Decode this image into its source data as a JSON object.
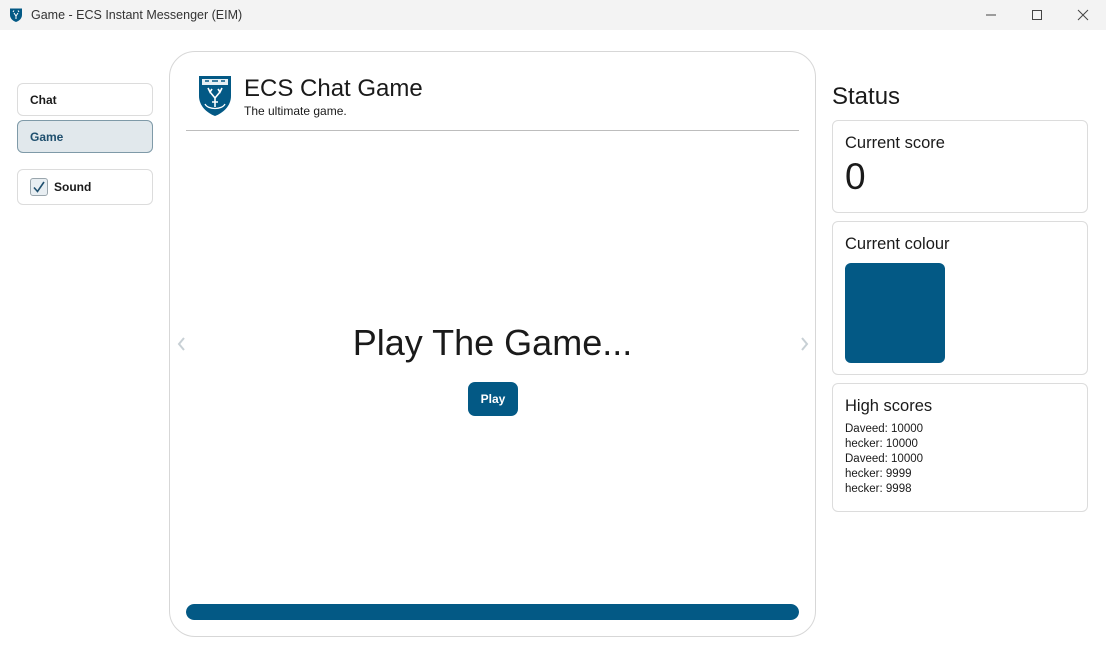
{
  "window": {
    "title": "Game - ECS Instant Messenger (EIM)",
    "app_icon": "shield-deer-icon",
    "controls": [
      "minimize-icon",
      "maximize-icon",
      "close-icon"
    ]
  },
  "sidebar": {
    "items": [
      {
        "label": "Chat",
        "active": false
      },
      {
        "label": "Game",
        "active": true
      }
    ],
    "sound": {
      "label": "Sound",
      "checked": true
    }
  },
  "game": {
    "logo": "shield-deer-icon",
    "title": "ECS Chat Game",
    "subtitle": "The ultimate game.",
    "heading": "Play The Game...",
    "play_label": "Play",
    "progress": 1.0,
    "nav_icons": [
      "chevron-left-icon",
      "chevron-right-icon"
    ]
  },
  "status": {
    "heading": "Status",
    "score": {
      "title": "Current score",
      "value": "0"
    },
    "colour": {
      "title": "Current colour",
      "hex": "#035985"
    },
    "high_scores": {
      "title": "High scores",
      "entries": [
        "Daveed: 10000",
        "hecker: 10000",
        "Daveed: 10000",
        "hecker: 9999",
        "hecker: 9998"
      ]
    }
  },
  "colors": {
    "accent": "#035985",
    "active_tab_bg": "#e1e8ec",
    "border": "#dcdcdc"
  }
}
